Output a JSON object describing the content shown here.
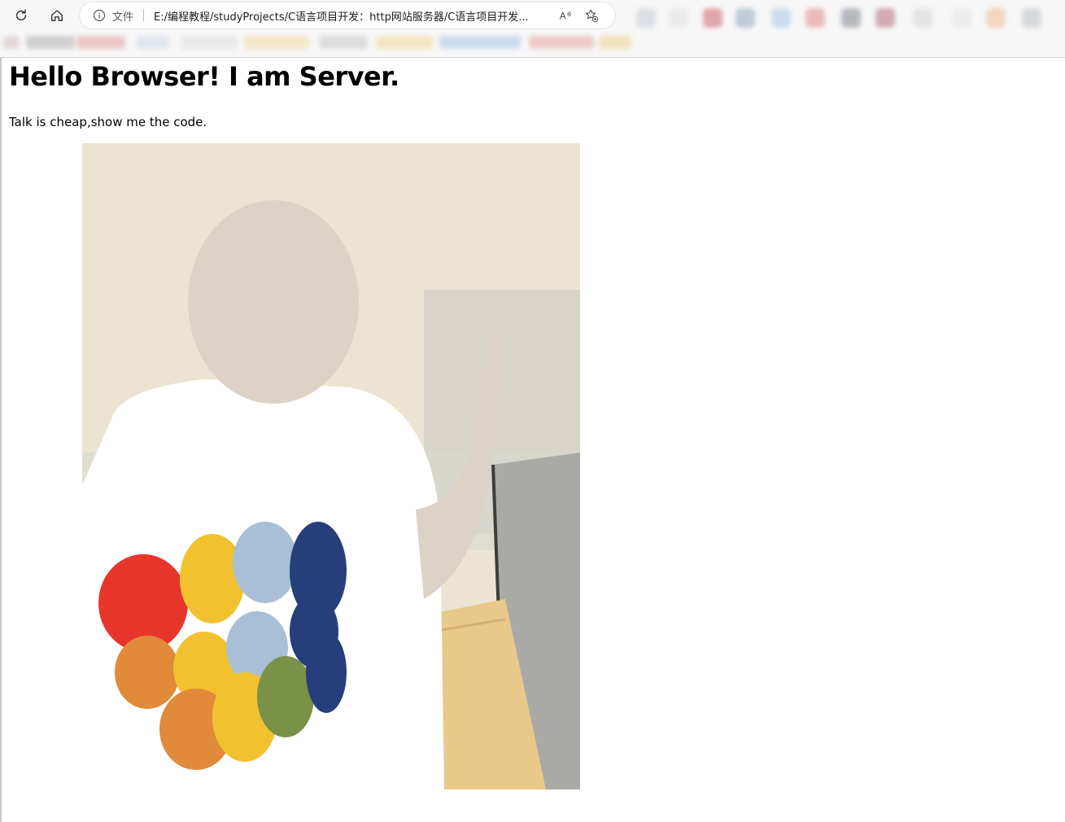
{
  "browser": {
    "scheme_label": "文件",
    "url": "E:/编程教程/studyProjects/C语言项目开发：http网站服务器/C语言项目开发...",
    "read_aloud_label": "A"
  },
  "page": {
    "heading": "Hello Browser! I am Server.",
    "paragraph": "Talk is cheap,show me the code.",
    "image": {
      "description": "photo"
    }
  },
  "colors": {
    "chrome_bg": "#f7f7f7",
    "page_bg": "#ffffff",
    "text": "#000000"
  }
}
